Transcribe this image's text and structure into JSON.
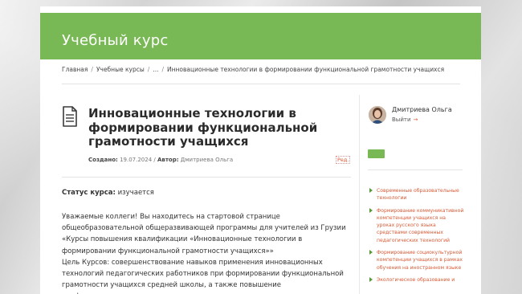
{
  "site": {
    "title": "Учебный курс"
  },
  "breadcrumb": {
    "items": [
      "Главная",
      "Учебные курсы",
      "...",
      "Инновационные технологии в формировании функциональной грамотности учащихся"
    ],
    "separator": "/"
  },
  "article": {
    "icon": "document-icon",
    "title": "Инновационные технологии в формировании функциональной грамотности учащихся",
    "created_label": "Создано:",
    "created_date": "19.07.2024",
    "meta_separator": "/",
    "author_label": "Автор:",
    "author_name": "Дмитриева Ольга",
    "edit_label": "Ред.",
    "status_label": "Статус курса:",
    "status_value": "изучается",
    "paragraphs": [
      "Уважаемые коллеги! Вы находитесь на стартовой странице общеобразовательной общеразвивающей программы для учителей из Грузии «Курсы повышения квалификации «Инновационные технологии в формировании функциональной грамотности учащихся»»",
      "Цель Курсов: совершенствование навыков применения инновационных технологий педагогических работников при формировании функциональной грамотности учащихся средней школы, а также повышение профессионального уровня в рамках"
    ]
  },
  "sidebar": {
    "user_name": "Дмитриева Ольга",
    "logout_label": "Выйти",
    "logout_arrow": "→",
    "links": [
      "Современные образовательные технологии",
      "Формирование коммуникативной компетенции учащихся на уроках русского языка средствами современных педагогических технологий",
      "Формирование социокультурной компетенции учащихся в рамках обучения на иностранном языке",
      "Экологическое образование и"
    ]
  },
  "colors": {
    "header": "#79b955",
    "link": "#d95a35",
    "bullet": "#5a9a3a"
  }
}
